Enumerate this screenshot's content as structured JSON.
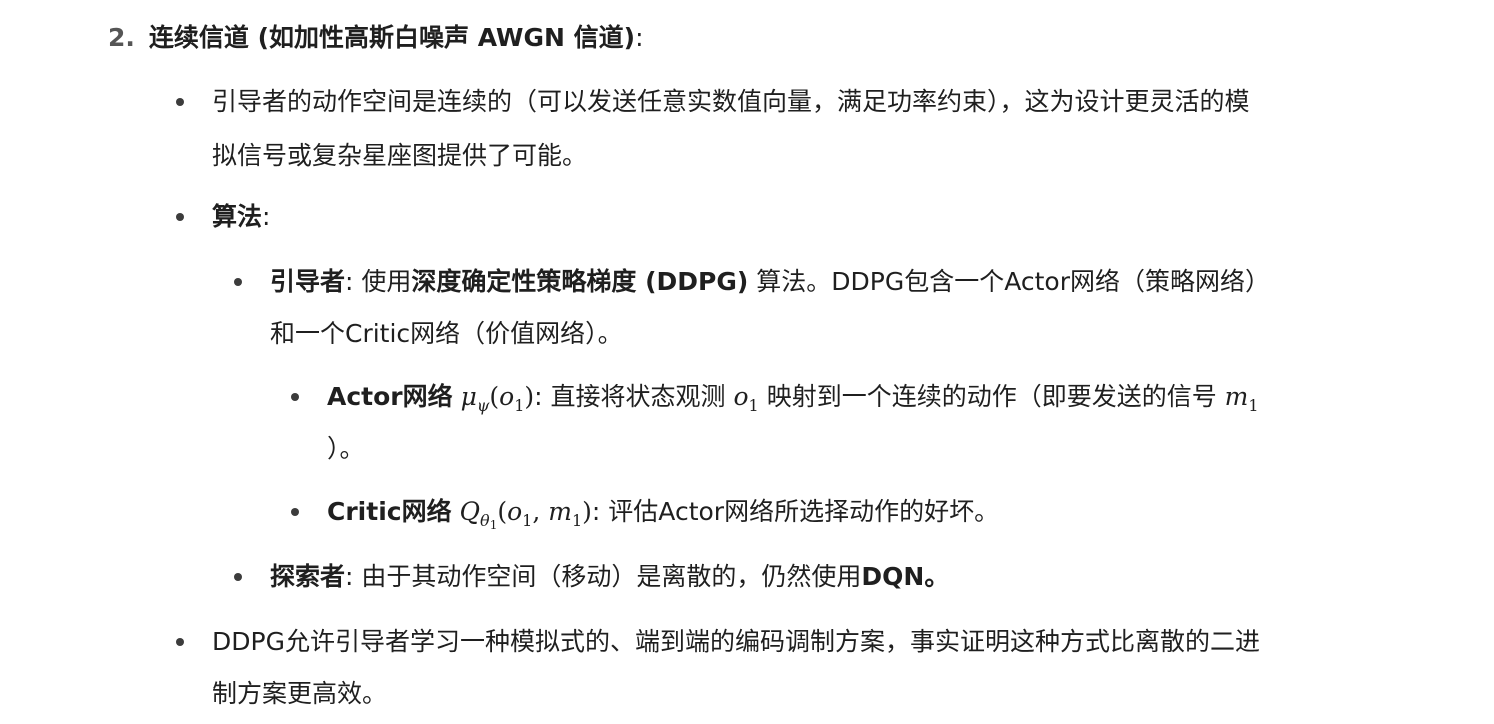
{
  "section": {
    "number": "2.",
    "title": "连续信道 (如加性高斯白噪声 AWGN 信道)",
    "colon": ":"
  },
  "bullets": {
    "continuous_action": {
      "line1": "引导者的动作空间是连续的（可以发送任意实数值向量，满足功率约束），这为设计更灵活的模",
      "line2": "拟信号或复杂星座图提供了可能。"
    },
    "algorithm": {
      "label": "算法",
      "colon": ":",
      "guide": {
        "label": "引导者",
        "colon": ": 使用",
        "method": "深度确定性策略梯度 (DDPG)",
        "rest_line1": " 算法。DDPG包含一个Actor网络（策略网络）",
        "line2": "和一个Critic网络（价值网络）。",
        "actor": {
          "label": "Actor网络",
          "math_fn": "μ",
          "math_sub": "ψ",
          "math_arg": "o",
          "math_arg_sub": "1",
          "text1": ": 直接将状态观测",
          "obs": "o",
          "obs_sub": "1",
          "text2": "映射到一个连续的动作（即要发送的信号",
          "sig": "m",
          "sig_sub": "1",
          "line2": "）。"
        },
        "critic": {
          "label": "Critic网络",
          "math_fn": "Q",
          "math_sub": "θ",
          "math_subsub": "1",
          "arg1": "o",
          "arg1_sub": "1",
          "arg2": "m",
          "arg2_sub": "1",
          "text": ": 评估Actor网络所选择动作的好坏。"
        }
      },
      "explorer": {
        "label": "探索者",
        "text": ": 由于其动作空间（移动）是离散的，仍然使用",
        "method": "DQN。"
      }
    },
    "ddpg_benefit": {
      "line1": "DDPG允许引导者学习一种模拟式的、端到端的编码调制方案，事实证明这种方式比离散的二进",
      "line2": "制方案更高效。"
    }
  }
}
